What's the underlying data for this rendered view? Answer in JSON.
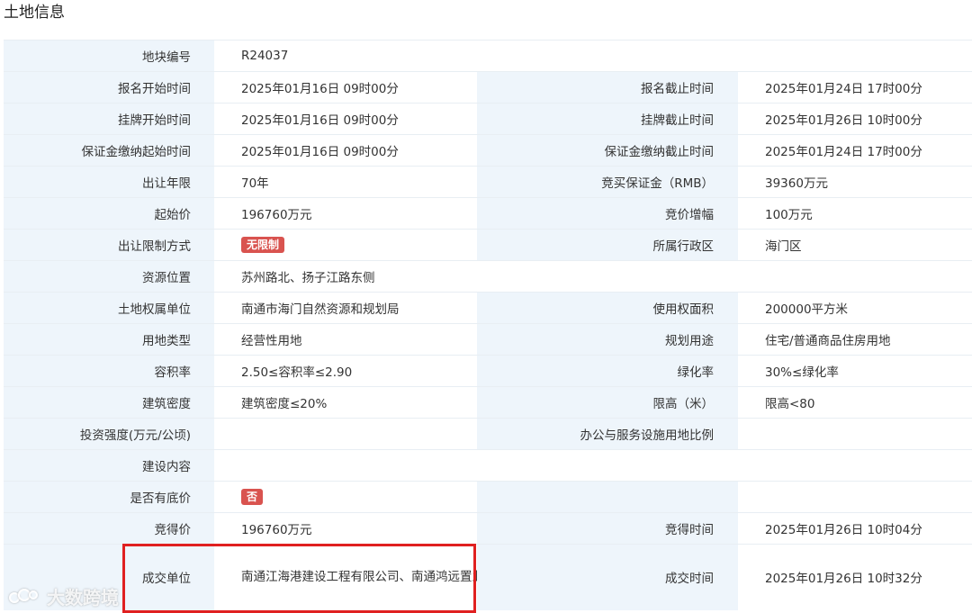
{
  "title": "土地信息",
  "rows": [
    {
      "l1": "地块编号",
      "v1": "R24037",
      "l2": "",
      "v2": ""
    },
    {
      "l1": "报名开始时间",
      "v1": "2025年01月16日 09时00分",
      "l2": "报名截止时间",
      "v2": "2025年01月24日 17时00分"
    },
    {
      "l1": "挂牌开始时间",
      "v1": "2025年01月16日 09时00分",
      "l2": "挂牌截止时间",
      "v2": "2025年01月26日 10时00分"
    },
    {
      "l1": "保证金缴纳起始时间",
      "v1": "2025年01月16日 09时00分",
      "l2": "保证金缴纳截止时间",
      "v2": "2025年01月24日 17时00分"
    },
    {
      "l1": "出让年限",
      "v1": "70年",
      "l2": "竞买保证金（RMB）",
      "v2": "39360万元"
    },
    {
      "l1": "起始价",
      "v1": "196760万元",
      "l2": "竞价增幅",
      "v2": "100万元"
    },
    {
      "l1": "出让限制方式",
      "badge1": "无限制",
      "l2": "所属行政区",
      "v2": "海门区"
    },
    {
      "l1": "资源位置",
      "v1": "苏州路北、扬子江路东侧"
    },
    {
      "l1": "土地权属单位",
      "v1": "南通市海门自然资源和规划局",
      "l2": "使用权面积",
      "v2": "200000平方米"
    },
    {
      "l1": "用地类型",
      "v1": "经营性用地",
      "l2": "规划用途",
      "v2": "住宅/普通商品住房用地"
    },
    {
      "l1": "容积率",
      "v1": "2.50≤容积率≤2.90",
      "l2": "绿化率",
      "v2": "30%≤绿化率"
    },
    {
      "l1": "建筑密度",
      "v1": "建筑密度≤20%",
      "l2": "限高（米）",
      "v2": "限高<80"
    },
    {
      "l1": "投资强度(万元/公顷)",
      "v1": "",
      "l2": "办公与服务设施用地比例",
      "v2": ""
    },
    {
      "l1": "建设内容",
      "v1": ""
    },
    {
      "l1": "是否有底价",
      "badge1": "否",
      "l2": "",
      "v2": ""
    },
    {
      "l1": "竞得价",
      "v1": "196760万元",
      "l2": "竞得时间",
      "v2": "2025年01月26日 10时04分"
    },
    {
      "l1": "成交单位",
      "v1": "南通江海港建设工程有限公司、南通鸿远置业有限公司、南通瑞城置业有限公司、南通市海门海泰置业有限公司",
      "l2": "成交时间",
      "v2": "2025年01月26日 10时32分"
    }
  ],
  "watermark": "大数跨境",
  "colors": {
    "label_bg": "#eef5fb",
    "badge": "#d9534f",
    "highlight": "#e02020"
  }
}
